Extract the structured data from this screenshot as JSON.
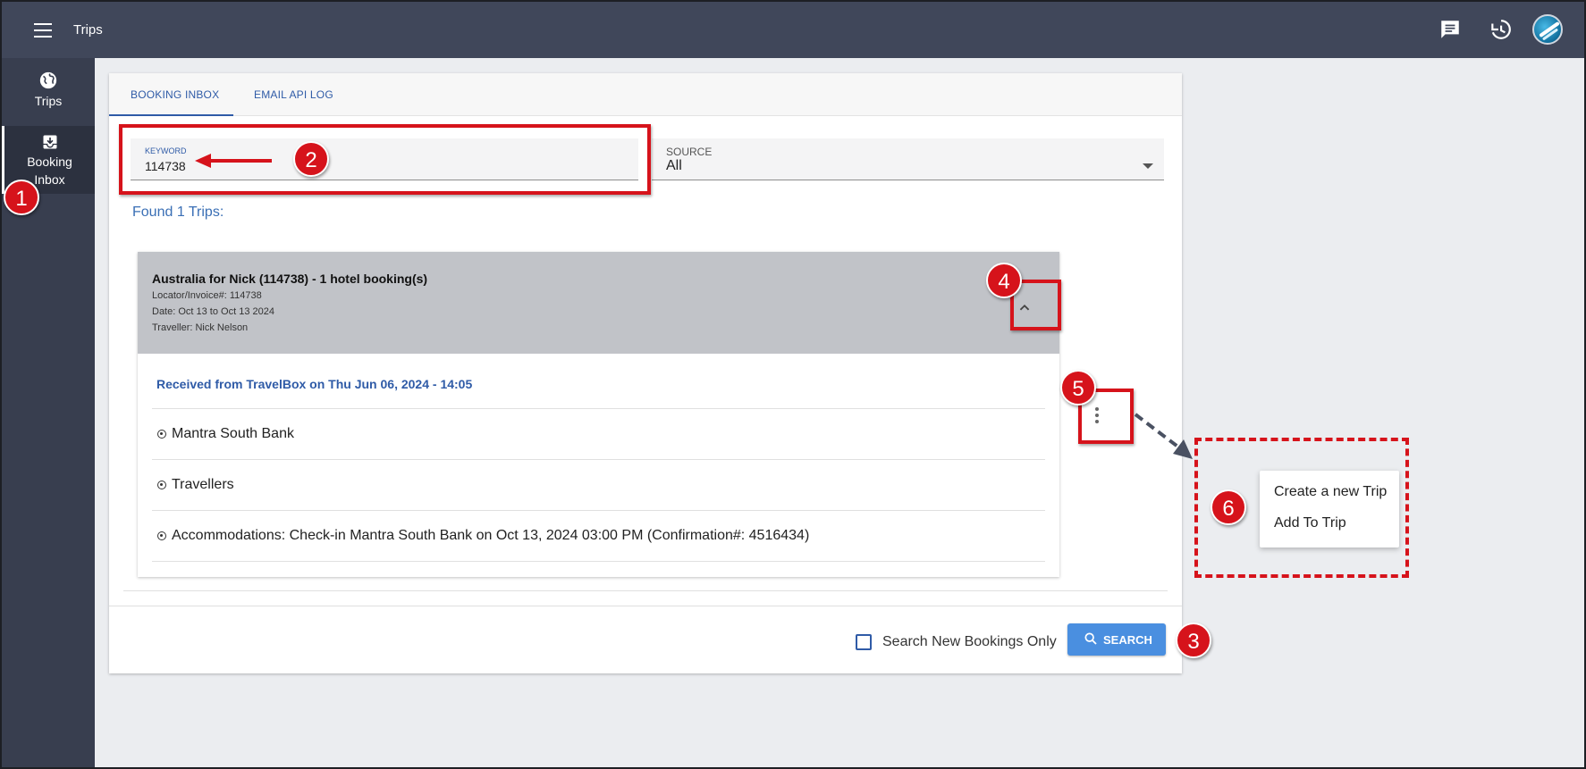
{
  "header": {
    "title": "Trips",
    "icons": [
      "menu-icon",
      "chat-icon",
      "history-icon",
      "avatar"
    ]
  },
  "sidebar": {
    "items": [
      {
        "label": "Trips",
        "icon": "globe-icon"
      },
      {
        "label_line1": "Booking",
        "label_line2": "Inbox",
        "icon": "inbox-download-icon",
        "active": true
      }
    ]
  },
  "tabs": [
    {
      "label": "BOOKING INBOX",
      "active": true
    },
    {
      "label": "EMAIL API LOG",
      "active": false
    }
  ],
  "filters": {
    "keyword_label": "KEYWORD",
    "keyword_value": "114738",
    "source_label": "SOURCE",
    "source_value": "All"
  },
  "results": {
    "found_text": "Found 1 Trips:",
    "trip": {
      "title": "Australia for Nick (114738) - 1 hotel booking(s)",
      "locator": "Locator/Invoice#: 114738",
      "date": "Date: Oct 13 to Oct 13 2024",
      "traveller": "Traveller: Nick Nelson",
      "received": "Received from TravelBox on Thu Jun 06, 2024 - 14:05",
      "items": [
        "Mantra South Bank",
        "Travellers",
        "Accommodations: Check-in Mantra South Bank on Oct 13, 2024 03:00 PM (Confirmation#: 4516434)"
      ]
    }
  },
  "footer": {
    "checkbox_label": "Search New Bookings Only",
    "search_label": "SEARCH"
  },
  "menu": {
    "items": [
      "Create a new Trip",
      "Add To Trip"
    ]
  },
  "annotations": [
    "1",
    "2",
    "3",
    "4",
    "5",
    "6"
  ],
  "colors": {
    "topbar": "#40475a",
    "sidebar": "#383e4f",
    "accent": "#2f5ba7",
    "search_button": "#4a8fe0",
    "annotation": "#d6131b"
  }
}
